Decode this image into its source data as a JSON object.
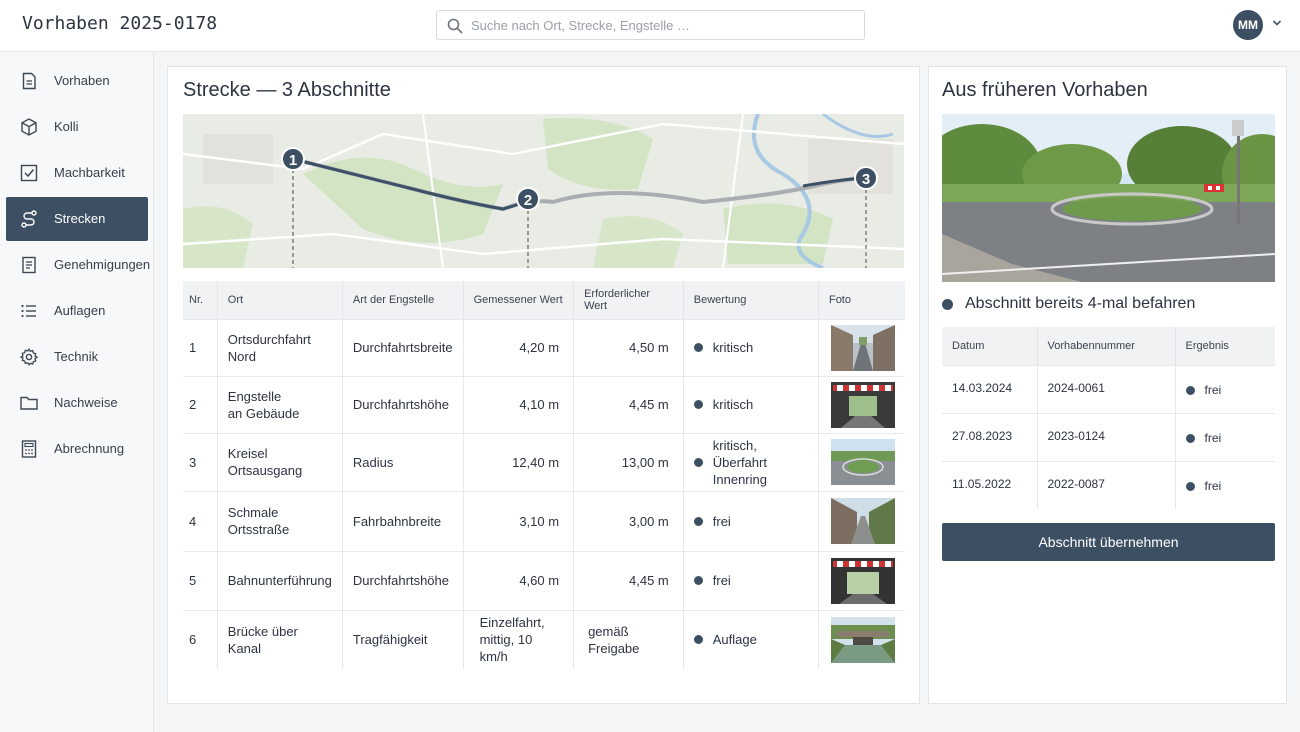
{
  "app": {
    "title": "Vorhaben 2025-0178"
  },
  "search": {
    "placeholder": "Suche nach Ort, Strecke, Engstelle …",
    "value": ""
  },
  "user": {
    "initials": "MM"
  },
  "sidebar": {
    "items": [
      {
        "label": "Vorhaben",
        "icon": "document-icon",
        "active": false
      },
      {
        "label": "Kolli",
        "icon": "package-icon",
        "active": false
      },
      {
        "label": "Machbarkeit",
        "icon": "checkbox-icon",
        "active": false
      },
      {
        "label": "Strecken",
        "icon": "route-icon",
        "active": true
      },
      {
        "label": "Genehmigungen",
        "icon": "document-icon",
        "active": false
      },
      {
        "label": "Auflagen",
        "icon": "list-icon",
        "active": false
      },
      {
        "label": "Technik",
        "icon": "gear-icon",
        "active": false
      },
      {
        "label": "Nachweise",
        "icon": "folder-icon",
        "active": false
      },
      {
        "label": "Abrechnung",
        "icon": "calculator-icon",
        "active": false
      }
    ]
  },
  "route": {
    "title": "Strecke — 3 Abschnitte",
    "markers": [
      "1",
      "2",
      "3"
    ],
    "columns": [
      "Nr.",
      "Ort",
      "Art der Engstelle",
      "Gemessener Wert",
      "Erforderlicher Wert",
      "Bewertung",
      "Foto"
    ],
    "rows": [
      {
        "nr": "1",
        "ort": [
          "Ortsdurchfahrt",
          "Nord"
        ],
        "art": "Durchfahrtsbreite",
        "gemessen": [
          "4,20  m"
        ],
        "erforderlich": "4,50  m",
        "bewertung": [
          "kritisch"
        ],
        "foto": "street-photo"
      },
      {
        "nr": "2",
        "ort": [
          "Engstelle",
          "an Gebäude"
        ],
        "art": "Durchfahrtshöhe",
        "gemessen": [
          "4,10  m"
        ],
        "erforderlich": "4,45  m",
        "bewertung": [
          "kritisch"
        ],
        "foto": "underpass-photo"
      },
      {
        "nr": "3",
        "ort": [
          "Kreisel",
          "Ortsausgang"
        ],
        "art": "Radius",
        "gemessen": [
          "12,40  m"
        ],
        "erforderlich": "13,00  m",
        "bewertung": [
          "kritisch,",
          "Überfahrt Innenring"
        ],
        "foto": "roundabout-photo"
      },
      {
        "nr": "4",
        "ort": [
          "Schmale",
          "Ortsstraße"
        ],
        "art": "Fahrbahnbreite",
        "gemessen": [
          "3,10  m"
        ],
        "erforderlich": "3,00  m",
        "bewertung": [
          "frei"
        ],
        "foto": "lane-photo"
      },
      {
        "nr": "5",
        "ort": [
          "Bahnunterführung"
        ],
        "art": "Durchfahrtshöhe",
        "gemessen": [
          "4,60  m"
        ],
        "erforderlich": "4,45  m",
        "bewertung": [
          "frei"
        ],
        "foto": "underpass-photo"
      },
      {
        "nr": "6",
        "ort": [
          "Brücke über Kanal"
        ],
        "art": "Tragfähigkeit",
        "gemessen": [
          "Einzelfahrt,",
          "mittig, 10 km/h"
        ],
        "erforderlich": "gemäß Freigabe",
        "bewertung": [
          "Auflage"
        ],
        "foto": "canal-bridge-photo"
      }
    ]
  },
  "history": {
    "title": "Aus früheren Vorhaben",
    "summary": "Abschnitt bereits 4-mal befahren",
    "columns": [
      "Datum",
      "Vorhabennummer",
      "Ergebnis"
    ],
    "rows": [
      {
        "datum": "14.03.2024",
        "nummer": "2024-0061",
        "ergebnis": "frei"
      },
      {
        "datum": "27.08.2023",
        "nummer": "2023-0124",
        "ergebnis": "frei"
      },
      {
        "datum": "11.05.2022",
        "nummer": "2022-0087",
        "ergebnis": "frei"
      }
    ],
    "button_label": "Abschnitt übernehmen"
  },
  "colors": {
    "accent": "#3d4f63",
    "map_bg": "#e9ede5",
    "route_line": "#3d5166"
  }
}
